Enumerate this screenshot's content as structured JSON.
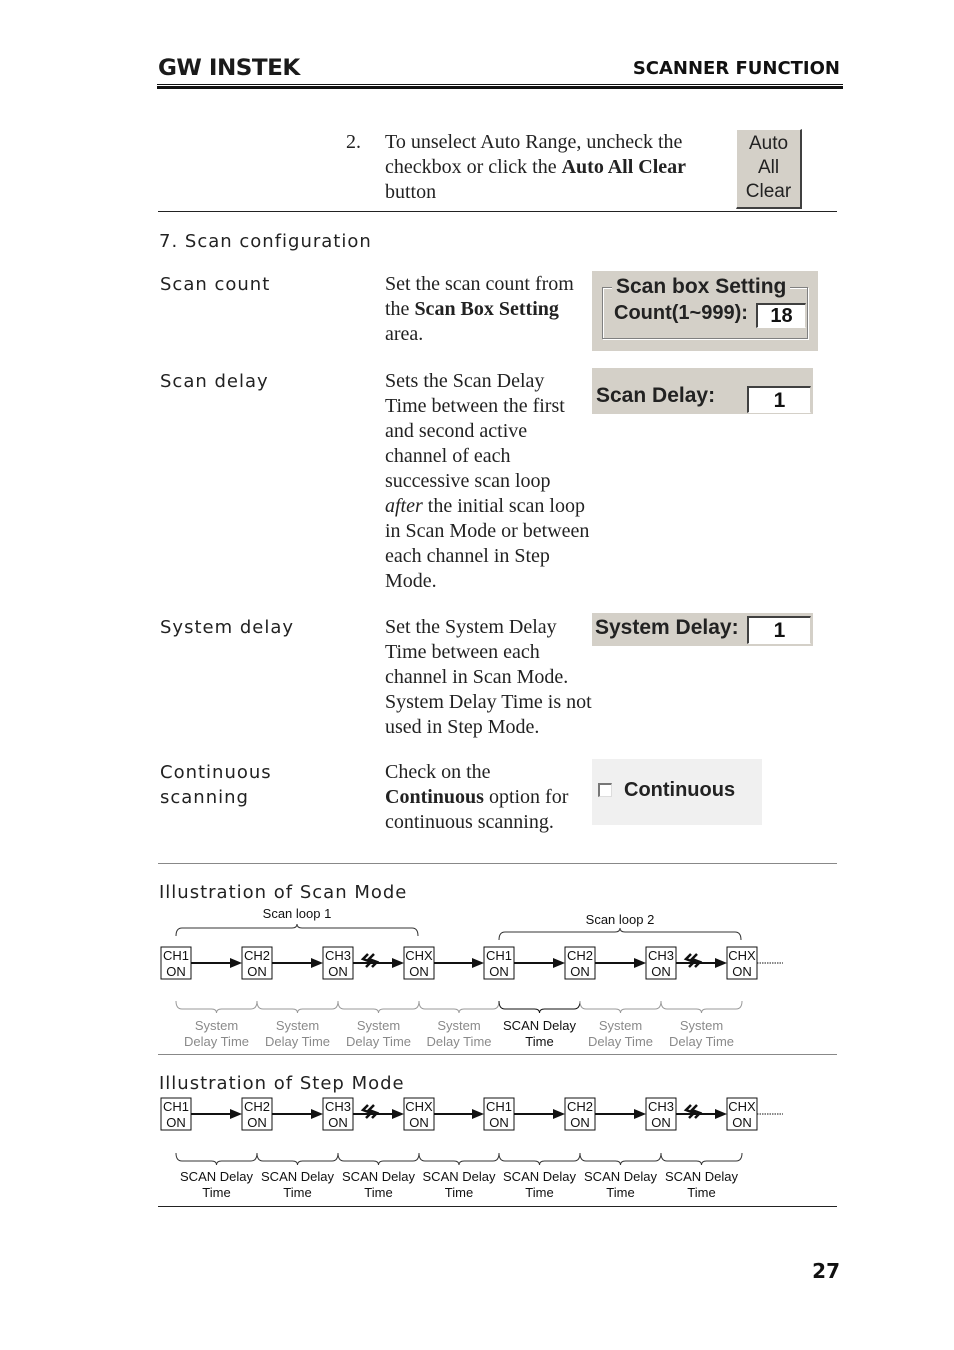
{
  "header": {
    "logo": "GW INSTEK",
    "section_title": "SCANNER FUNCTION"
  },
  "step2": {
    "number": "2.",
    "text_before": "To unselect Auto Range, uncheck the checkbox or click the ",
    "text_bold": "Auto All Clear",
    "text_after": " button",
    "button_lines": [
      "Auto",
      "All",
      "Clear"
    ]
  },
  "section": {
    "title": "7. Scan configuration"
  },
  "rows": [
    {
      "label": "Scan count",
      "desc_parts": [
        {
          "t": "Set the scan count from the ",
          "style": "normal"
        },
        {
          "t": "Scan Box Setting",
          "style": "bold"
        },
        {
          "t": " area.",
          "style": "normal"
        }
      ],
      "widget": {
        "group_title": "Scan box Setting",
        "field_label": "Count(1~999):",
        "value": "18"
      }
    },
    {
      "label": "Scan delay",
      "desc_parts": [
        {
          "t": "Sets the Scan Delay Time between the first and second active channel of  each successive scan loop ",
          "style": "normal"
        },
        {
          "t": "after",
          "style": "italic"
        },
        {
          "t": " the initial scan loop in Scan Mode or between each channel in Step Mode.",
          "style": "normal"
        }
      ],
      "widget": {
        "field_label": "Scan Delay:",
        "value": "1"
      }
    },
    {
      "label": "System delay",
      "desc_parts": [
        {
          "t": "Set the System Delay Time between each channel in Scan Mode. System Delay Time is not used in Step Mode.",
          "style": "normal"
        }
      ],
      "widget": {
        "field_label": "System Delay:",
        "value": "1"
      }
    },
    {
      "label_lines": [
        "Continuous",
        "scanning"
      ],
      "desc_parts": [
        {
          "t": "Check on the ",
          "style": "normal"
        },
        {
          "t": "Continuous",
          "style": "bold"
        },
        {
          "t": " option for continuous scanning.",
          "style": "normal"
        }
      ],
      "widget": {
        "checkbox_label": "Continuous",
        "checked": false
      }
    }
  ],
  "scan_mode": {
    "title": "Illustration of Scan Mode",
    "loops": [
      "Scan loop 1",
      "Scan loop 2"
    ],
    "channels": [
      {
        "ch": "CH1",
        "state": "ON"
      },
      {
        "ch": "CH2",
        "state": "ON"
      },
      {
        "ch": "CH3",
        "state": "ON"
      },
      {
        "ch": "CHX",
        "state": "ON"
      },
      {
        "ch": "CH1",
        "state": "ON"
      },
      {
        "ch": "CH2",
        "state": "ON"
      },
      {
        "ch": "CH3",
        "state": "ON"
      },
      {
        "ch": "CHX",
        "state": "ON"
      }
    ],
    "intervals": [
      {
        "l1": "System",
        "l2": "Delay Time",
        "highlight": false
      },
      {
        "l1": "System",
        "l2": "Delay Time",
        "highlight": false
      },
      {
        "l1": "System",
        "l2": "Delay Time",
        "highlight": false
      },
      {
        "l1": "System",
        "l2": "Delay Time",
        "highlight": false
      },
      {
        "l1": "SCAN Delay",
        "l2": "Time",
        "highlight": true
      },
      {
        "l1": "System",
        "l2": "Delay Time",
        "highlight": false
      },
      {
        "l1": "System",
        "l2": "Delay Time",
        "highlight": false
      }
    ]
  },
  "step_mode": {
    "title": "Illustration of Step Mode",
    "channels": [
      {
        "ch": "CH1",
        "state": "ON"
      },
      {
        "ch": "CH2",
        "state": "ON"
      },
      {
        "ch": "CH3",
        "state": "ON"
      },
      {
        "ch": "CHX",
        "state": "ON"
      },
      {
        "ch": "CH1",
        "state": "ON"
      },
      {
        "ch": "CH2",
        "state": "ON"
      },
      {
        "ch": "CH3",
        "state": "ON"
      },
      {
        "ch": "CHX",
        "state": "ON"
      }
    ],
    "intervals": [
      {
        "l1": "SCAN Delay",
        "l2": "Time"
      },
      {
        "l1": "SCAN Delay",
        "l2": "Time"
      },
      {
        "l1": "SCAN Delay",
        "l2": "Time"
      },
      {
        "l1": "SCAN Delay",
        "l2": "Time"
      },
      {
        "l1": "SCAN Delay",
        "l2": "Time"
      },
      {
        "l1": "SCAN Delay",
        "l2": "Time"
      },
      {
        "l1": "SCAN Delay",
        "l2": "Time"
      }
    ]
  },
  "colors": {
    "widget_bg": "#d4d0c8",
    "dim_text": "#8a8a8a"
  },
  "page_number": "27"
}
